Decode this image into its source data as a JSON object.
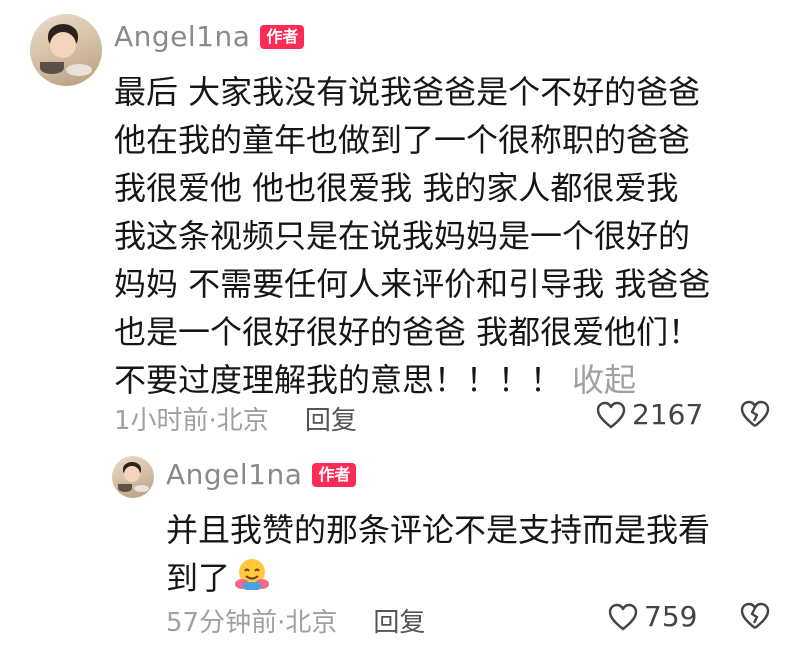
{
  "comments": [
    {
      "author": "Angel1na",
      "badge": "作者",
      "lines": [
        "最后 大家我没有说我爸爸是个不好的爸爸",
        "他在我的童年也做到了一个很称职的爸爸",
        "我很爱他 他也很爱我 我的家人都很爱我",
        "我这条视频只是在说我妈妈是一个很好的",
        "妈妈 不需要任何人来评价和引导我 我爸爸",
        "也是一个很好很好的爸爸 我都很爱他们！",
        "不要过度理解我的意思！！！！"
      ],
      "collapse": "收起",
      "meta": "1小时前·北京",
      "reply": "回复",
      "likes": "2167"
    },
    {
      "author": "Angel1na",
      "badge": "作者",
      "lines": [
        "并且我赞的那条评论不是支持而是我看",
        "到了"
      ],
      "emoji": "hugging-face-emoji",
      "meta": "57分钟前·北京",
      "reply": "回复",
      "likes": "759"
    }
  ],
  "colors": {
    "badge": "#fe2c55",
    "name": "#8a8a8a",
    "meta": "#a0a0a0",
    "text": "#161616"
  }
}
